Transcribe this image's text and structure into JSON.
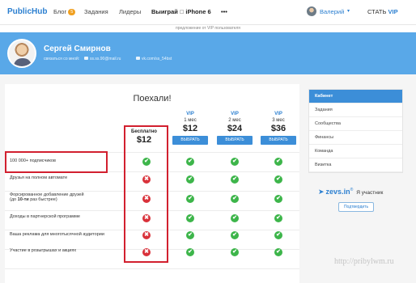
{
  "topnav": {
    "logo": "PublicHub",
    "blog": "Блог",
    "blog_badge": "5",
    "tasks": "Задания",
    "leaders": "Лидеры",
    "promo": "Выиграй",
    "promo_icon": "apple-icon",
    "promo_item": "iPhone 6",
    "more": "•••",
    "user_name": "Валерий",
    "become": "СТАТЬ",
    "vip": "VIP"
  },
  "offer_bar": "предложение от VIP пользователя",
  "profile": {
    "name": "Сергей Смирнов",
    "contact_label": "связаться со мной:",
    "email": "ss.ss.90@mail.ru",
    "vk": "vk.com/ss_54bst"
  },
  "main": {
    "title": "Поехали!",
    "free_label": "Бесплатно",
    "free_price": "$12",
    "plans": [
      {
        "vip": "VIP",
        "period": "1 мес",
        "price": "$12",
        "button": "ВЫБРАТЬ"
      },
      {
        "vip": "VIP",
        "period": "2 мес",
        "price": "$24",
        "button": "ВЫБРАТЬ"
      },
      {
        "vip": "VIP",
        "period": "3 мес",
        "price": "$36",
        "button": "ВЫБРАТЬ"
      }
    ],
    "features": [
      {
        "text": "100 000+ подписчиков",
        "free": true
      },
      {
        "text": "Друзья на полном автомате",
        "free": false
      },
      {
        "text_line1": "Форсированное добавление друзей",
        "text_line2_prefix": "(до ",
        "text_line2_bold": "10-ти",
        "text_line2_suffix": " раз быстрее)",
        "free": false
      },
      {
        "text": "Доходы в партнерской программе",
        "free": false
      },
      {
        "text": "Ваша реклама для многотысячной аудитории",
        "free": false
      },
      {
        "text": "Участие в розыгрышах и акциях",
        "free": false
      }
    ],
    "ok_glyph": "✔",
    "no_glyph": "✖"
  },
  "sidebar": {
    "items": [
      "Кабинет",
      "Задания",
      "Сообщества",
      "Финансы",
      "Команда",
      "Визитка"
    ],
    "active": "Кабинет"
  },
  "partner": {
    "logo": "zevs.in",
    "logo_suffix": "®",
    "text": "Я участник",
    "button": "Подтвердить"
  },
  "watermark": "http://pribylwm.ru",
  "colors": {
    "brand_blue": "#2b7fd0",
    "header_blue": "#59a8e8",
    "ok_green": "#3db54a",
    "no_red": "#d9313a",
    "highlight_red": "#d2202f"
  }
}
